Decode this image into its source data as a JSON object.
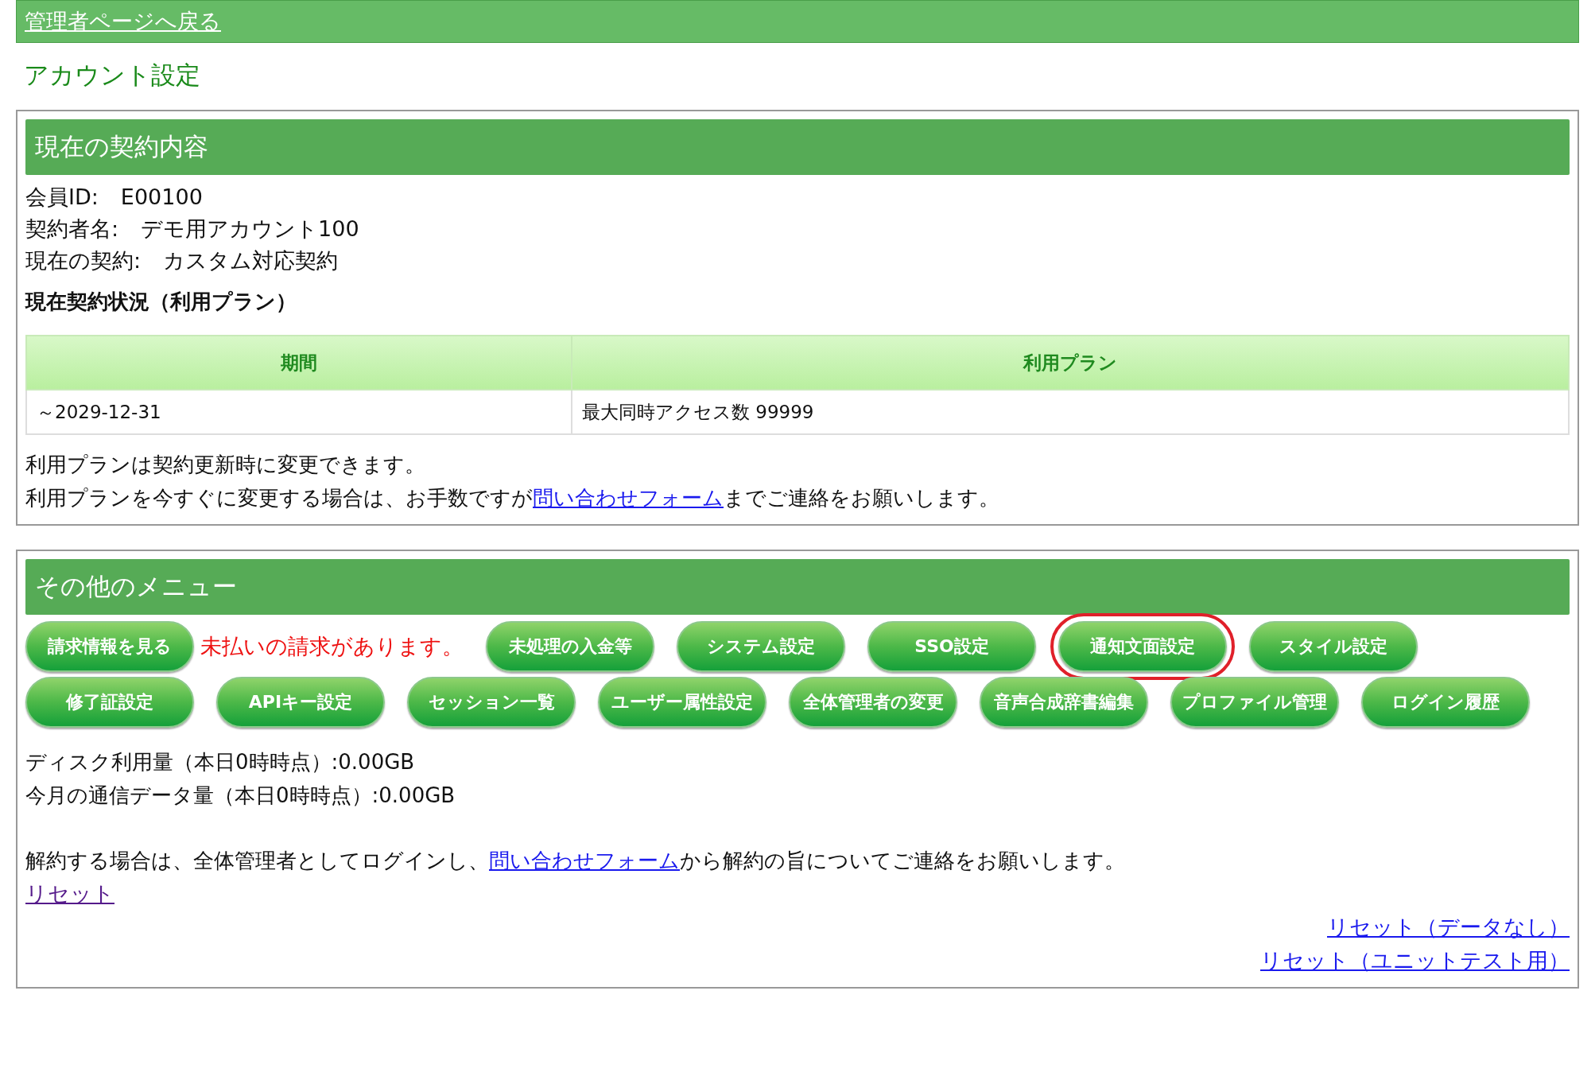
{
  "top_bar": {
    "back_link": "管理者ページへ戻る"
  },
  "page_title": "アカウント設定",
  "contract_panel": {
    "heading": "現在の契約内容",
    "fields": [
      {
        "label": "会員ID:",
        "value": "E00100"
      },
      {
        "label": "契約者名:",
        "value": "デモ用アカウント100"
      },
      {
        "label": "現在の契約:",
        "value": "カスタム対応契約"
      }
    ],
    "plan_heading": "現在契約状況（利用プラン）",
    "table": {
      "columns": [
        "期間",
        "利用プラン"
      ],
      "rows": [
        [
          "～2029-12-31",
          "最大同時アクセス数 99999"
        ]
      ]
    },
    "note": "利用プランは契約更新時に変更できます。",
    "contact": {
      "before": "利用プランを今すぐに変更する場合は、お手数ですが",
      "link": "問い合わせフォーム",
      "after": "までご連絡をお願いします。"
    }
  },
  "menu_panel": {
    "heading": "その他のメニュー",
    "items": [
      {
        "kind": "button",
        "label": "請求情報を見る",
        "highlighted": false
      },
      {
        "kind": "alert",
        "label": "未払いの請求があります。"
      },
      {
        "kind": "button",
        "label": "未処理の入金等",
        "highlighted": false
      },
      {
        "kind": "button",
        "label": "システム設定",
        "highlighted": false
      },
      {
        "kind": "button",
        "label": "SSO設定",
        "highlighted": false
      },
      {
        "kind": "button",
        "label": "通知文面設定",
        "highlighted": true
      },
      {
        "kind": "button",
        "label": "スタイル設定",
        "highlighted": false
      },
      {
        "kind": "button",
        "label": "修了証設定",
        "highlighted": false
      },
      {
        "kind": "button",
        "label": "APIキー設定",
        "highlighted": false
      },
      {
        "kind": "button",
        "label": "セッション一覧",
        "highlighted": false
      },
      {
        "kind": "button",
        "label": "ユーザー属性設定",
        "highlighted": false
      },
      {
        "kind": "button",
        "label": "全体管理者の変更",
        "highlighted": false
      },
      {
        "kind": "button",
        "label": "音声合成辞書編集",
        "highlighted": false
      },
      {
        "kind": "button",
        "label": "プロファイル管理",
        "highlighted": false
      },
      {
        "kind": "button",
        "label": "ログイン履歴",
        "highlighted": false
      }
    ],
    "usage": [
      "ディスク利用量（本日0時時点）:0.00GB",
      "今月の通信データ量（本日0時時点）:0.00GB"
    ],
    "cancel": {
      "before": "解約する場合は、全体管理者としてログインし、",
      "link": "問い合わせフォーム",
      "after": "から解約の旨についてご連絡をお願いします。"
    },
    "reset_link": {
      "label": "リセット",
      "visited": true
    },
    "right_links": [
      {
        "label": "リセット（データなし）",
        "visited": false
      },
      {
        "label": "リセット（ユニットテスト用）",
        "visited": false
      }
    ]
  }
}
